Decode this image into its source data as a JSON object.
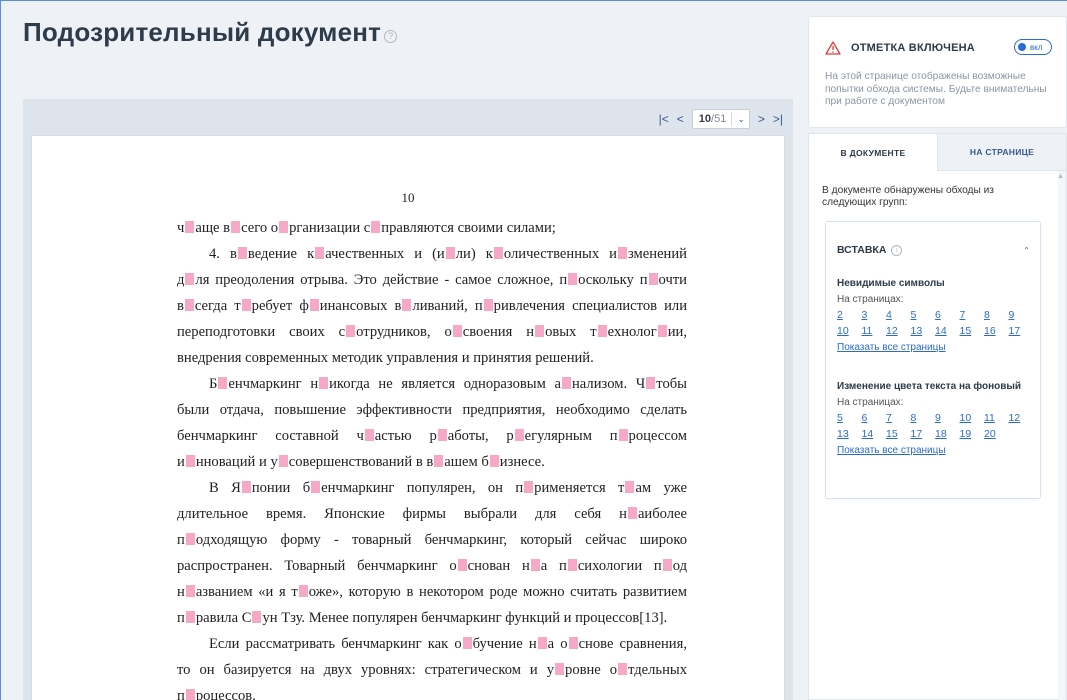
{
  "page": {
    "title": "Подозрительный документ",
    "help_icon": "question-circle-icon"
  },
  "pager": {
    "first_icon": "|<",
    "prev_icon": "<",
    "current": "10",
    "total": "/51",
    "next_icon": ">",
    "last_icon": ">|"
  },
  "document": {
    "page_number": "10",
    "mark_color": "#f6a8c6",
    "lines": [
      {
        "style": "plain",
        "parts": [
          "ч",
          "аще в",
          "сего о",
          "рганизации с",
          "правляются своими силами;"
        ]
      },
      {
        "style": "justify-indent",
        "parts": [
          "4.  в",
          "ведение к",
          "ачественных и (и",
          "ли) к",
          "оличественных и",
          "зменений"
        ]
      },
      {
        "style": "justify",
        "parts": [
          "д",
          "ля преодоления отрыва. Это действие - самое сложное, п",
          "оскольку п",
          "очти"
        ]
      },
      {
        "style": "justify",
        "parts": [
          "в",
          "сегда т",
          "ребует ф",
          "инансовых в",
          "ливаний, п",
          "ривлечения специалистов или"
        ]
      },
      {
        "style": "justify",
        "parts": [
          "переподготовки  своих  с",
          "отрудников,  о",
          "своения  н",
          "овых  т",
          "ехнолог",
          "ии,"
        ]
      },
      {
        "style": "plain",
        "parts": [
          "внедрения современных методик управления и принятия решений."
        ]
      },
      {
        "style": "justify-indent",
        "parts": [
          "Б",
          "енчмаркинг н",
          "икогда не является одноразовым а",
          "нализом. Ч",
          "тобы"
        ]
      },
      {
        "style": "justify",
        "parts": [
          "были отдача, повышение эффективности предприятия, необходимо сделать"
        ]
      },
      {
        "style": "justify",
        "parts": [
          "бенчмаркинг  составной  ч",
          "астью  р",
          "аботы,  р",
          "егулярным  п",
          "роцессом"
        ]
      },
      {
        "style": "plain",
        "parts": [
          "и",
          "нноваций и у",
          "совершенствований в в",
          "ашем б",
          "изнесе."
        ]
      },
      {
        "style": "justify-indent",
        "parts": [
          "В  Я",
          "понии  б",
          "енчмаркинг  популярен,  он  п",
          "рименяется  т",
          "ам  уже"
        ]
      },
      {
        "style": "justify",
        "parts": [
          "длительное  время.  Японские  фирмы  выбрали  для  себя  н",
          "аиболее"
        ]
      },
      {
        "style": "justify",
        "parts": [
          "п",
          "одходящую форму - товарный бенчмаркинг, который сейчас широко"
        ]
      },
      {
        "style": "justify",
        "parts": [
          "распространен. Товарный бенчмаркинг о",
          "снован н",
          "а п",
          "сихологии п",
          "од"
        ]
      },
      {
        "style": "justify",
        "parts": [
          "н",
          "азванием «и я т",
          "оже», которую в некотором роде можно считать развитием"
        ]
      },
      {
        "style": "plain",
        "parts": [
          "п",
          "равила С",
          "ун Тзу. Менее популярен бенчмаркинг функций и процессов[13]."
        ]
      },
      {
        "style": "justify-indent",
        "parts": [
          "Если рассматривать бенчмаркинг как о",
          "бучение н",
          "а о",
          "снове сравнения,"
        ]
      },
      {
        "style": "justify",
        "parts": [
          "то он базируется на двух уровнях: стратегическом и у",
          "ровне о",
          "тдельных"
        ]
      },
      {
        "style": "plain",
        "parts": [
          "п",
          "роцессов."
        ]
      }
    ]
  },
  "alert": {
    "icon": "warning-triangle-icon",
    "warning_color": "#e23c3c",
    "title": "ОТМЕТКА ВКЛЮЧЕНА",
    "toggle_label": "вкл",
    "text": "На этой странице отображены возможные попытки обхода системы. Будьте внимательны при работе с документом"
  },
  "panel": {
    "tabs": [
      {
        "label": "В ДОКУМЕНТЕ",
        "active": true
      },
      {
        "label": "НА СТРАНИЦЕ",
        "active": false
      }
    ],
    "intro": "В документе обнаружены обходы из следующих групп:",
    "group": {
      "title": "ВСТАВКА",
      "subgroups": [
        {
          "title": "Невидимые символы",
          "pages_label": "На страницах:",
          "pages": [
            "2",
            "3",
            "4",
            "5",
            "6",
            "7",
            "8",
            "9",
            "10",
            "11",
            "12",
            "13",
            "14",
            "15",
            "16",
            "17"
          ],
          "show_all": "Показать все страницы"
        },
        {
          "title": "Изменение цвета текста на фоновый",
          "pages_label": "На страницах:",
          "pages": [
            "5",
            "6",
            "7",
            "8",
            "9",
            "10",
            "11",
            "12",
            "13",
            "14",
            "15",
            "17",
            "18",
            "19",
            "20"
          ],
          "show_all": "Показать все страницы"
        }
      ]
    }
  }
}
